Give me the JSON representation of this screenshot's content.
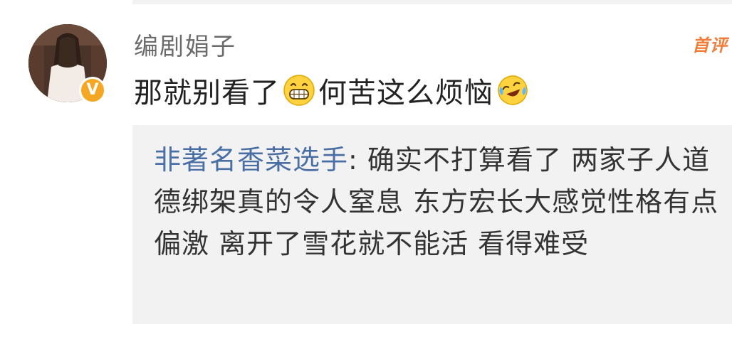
{
  "comment": {
    "username": "编剧娟子",
    "first_comment_badge": "首评",
    "text_part1": "那就别看了",
    "emoji1": "grinning-teeth-emoji",
    "text_part2": "何苦这么烦恼",
    "emoji2": "laugh-cry-emoji",
    "verified_badge": "V"
  },
  "reply": {
    "username": "非著名香菜选手",
    "separator": ": ",
    "text": "确实不打算看了 两家子人道德绑架真的令人窒息 东方宏长大感觉性格有点偏激 离开了雪花就不能活 看得难受"
  },
  "colors": {
    "link_blue": "#4a6fa5",
    "badge_orange": "#f07d3a",
    "verified_gold": "#f5a623",
    "reply_bg": "#f2f2f2"
  }
}
